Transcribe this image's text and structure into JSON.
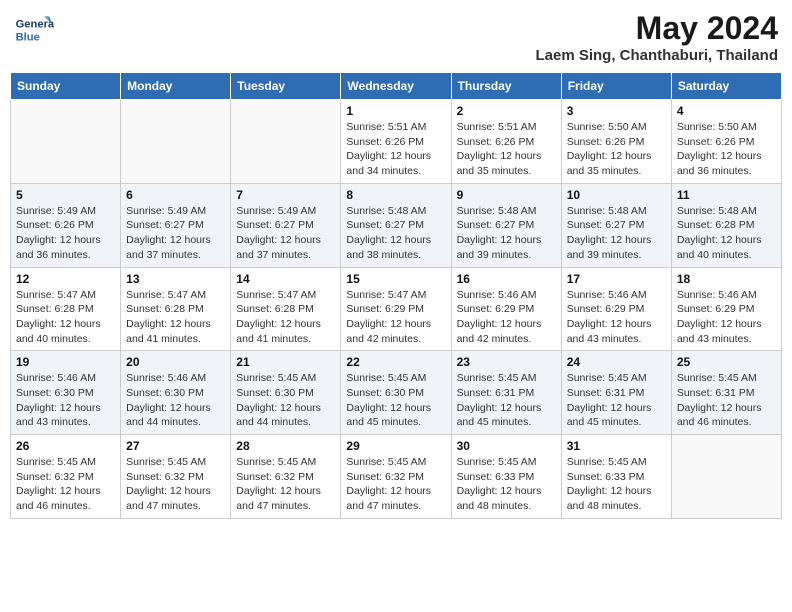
{
  "header": {
    "logo_line1": "General",
    "logo_line2": "Blue",
    "month_title": "May 2024",
    "location": "Laem Sing, Chanthaburi, Thailand"
  },
  "days_of_week": [
    "Sunday",
    "Monday",
    "Tuesday",
    "Wednesday",
    "Thursday",
    "Friday",
    "Saturday"
  ],
  "weeks": [
    [
      {
        "day": "",
        "info": ""
      },
      {
        "day": "",
        "info": ""
      },
      {
        "day": "",
        "info": ""
      },
      {
        "day": "1",
        "info": "Sunrise: 5:51 AM\nSunset: 6:26 PM\nDaylight: 12 hours and 34 minutes."
      },
      {
        "day": "2",
        "info": "Sunrise: 5:51 AM\nSunset: 6:26 PM\nDaylight: 12 hours and 35 minutes."
      },
      {
        "day": "3",
        "info": "Sunrise: 5:50 AM\nSunset: 6:26 PM\nDaylight: 12 hours and 35 minutes."
      },
      {
        "day": "4",
        "info": "Sunrise: 5:50 AM\nSunset: 6:26 PM\nDaylight: 12 hours and 36 minutes."
      }
    ],
    [
      {
        "day": "5",
        "info": "Sunrise: 5:49 AM\nSunset: 6:26 PM\nDaylight: 12 hours and 36 minutes."
      },
      {
        "day": "6",
        "info": "Sunrise: 5:49 AM\nSunset: 6:27 PM\nDaylight: 12 hours and 37 minutes."
      },
      {
        "day": "7",
        "info": "Sunrise: 5:49 AM\nSunset: 6:27 PM\nDaylight: 12 hours and 37 minutes."
      },
      {
        "day": "8",
        "info": "Sunrise: 5:48 AM\nSunset: 6:27 PM\nDaylight: 12 hours and 38 minutes."
      },
      {
        "day": "9",
        "info": "Sunrise: 5:48 AM\nSunset: 6:27 PM\nDaylight: 12 hours and 39 minutes."
      },
      {
        "day": "10",
        "info": "Sunrise: 5:48 AM\nSunset: 6:27 PM\nDaylight: 12 hours and 39 minutes."
      },
      {
        "day": "11",
        "info": "Sunrise: 5:48 AM\nSunset: 6:28 PM\nDaylight: 12 hours and 40 minutes."
      }
    ],
    [
      {
        "day": "12",
        "info": "Sunrise: 5:47 AM\nSunset: 6:28 PM\nDaylight: 12 hours and 40 minutes."
      },
      {
        "day": "13",
        "info": "Sunrise: 5:47 AM\nSunset: 6:28 PM\nDaylight: 12 hours and 41 minutes."
      },
      {
        "day": "14",
        "info": "Sunrise: 5:47 AM\nSunset: 6:28 PM\nDaylight: 12 hours and 41 minutes."
      },
      {
        "day": "15",
        "info": "Sunrise: 5:47 AM\nSunset: 6:29 PM\nDaylight: 12 hours and 42 minutes."
      },
      {
        "day": "16",
        "info": "Sunrise: 5:46 AM\nSunset: 6:29 PM\nDaylight: 12 hours and 42 minutes."
      },
      {
        "day": "17",
        "info": "Sunrise: 5:46 AM\nSunset: 6:29 PM\nDaylight: 12 hours and 43 minutes."
      },
      {
        "day": "18",
        "info": "Sunrise: 5:46 AM\nSunset: 6:29 PM\nDaylight: 12 hours and 43 minutes."
      }
    ],
    [
      {
        "day": "19",
        "info": "Sunrise: 5:46 AM\nSunset: 6:30 PM\nDaylight: 12 hours and 43 minutes."
      },
      {
        "day": "20",
        "info": "Sunrise: 5:46 AM\nSunset: 6:30 PM\nDaylight: 12 hours and 44 minutes."
      },
      {
        "day": "21",
        "info": "Sunrise: 5:45 AM\nSunset: 6:30 PM\nDaylight: 12 hours and 44 minutes."
      },
      {
        "day": "22",
        "info": "Sunrise: 5:45 AM\nSunset: 6:30 PM\nDaylight: 12 hours and 45 minutes."
      },
      {
        "day": "23",
        "info": "Sunrise: 5:45 AM\nSunset: 6:31 PM\nDaylight: 12 hours and 45 minutes."
      },
      {
        "day": "24",
        "info": "Sunrise: 5:45 AM\nSunset: 6:31 PM\nDaylight: 12 hours and 45 minutes."
      },
      {
        "day": "25",
        "info": "Sunrise: 5:45 AM\nSunset: 6:31 PM\nDaylight: 12 hours and 46 minutes."
      }
    ],
    [
      {
        "day": "26",
        "info": "Sunrise: 5:45 AM\nSunset: 6:32 PM\nDaylight: 12 hours and 46 minutes."
      },
      {
        "day": "27",
        "info": "Sunrise: 5:45 AM\nSunset: 6:32 PM\nDaylight: 12 hours and 47 minutes."
      },
      {
        "day": "28",
        "info": "Sunrise: 5:45 AM\nSunset: 6:32 PM\nDaylight: 12 hours and 47 minutes."
      },
      {
        "day": "29",
        "info": "Sunrise: 5:45 AM\nSunset: 6:32 PM\nDaylight: 12 hours and 47 minutes."
      },
      {
        "day": "30",
        "info": "Sunrise: 5:45 AM\nSunset: 6:33 PM\nDaylight: 12 hours and 48 minutes."
      },
      {
        "day": "31",
        "info": "Sunrise: 5:45 AM\nSunset: 6:33 PM\nDaylight: 12 hours and 48 minutes."
      },
      {
        "day": "",
        "info": ""
      }
    ]
  ]
}
